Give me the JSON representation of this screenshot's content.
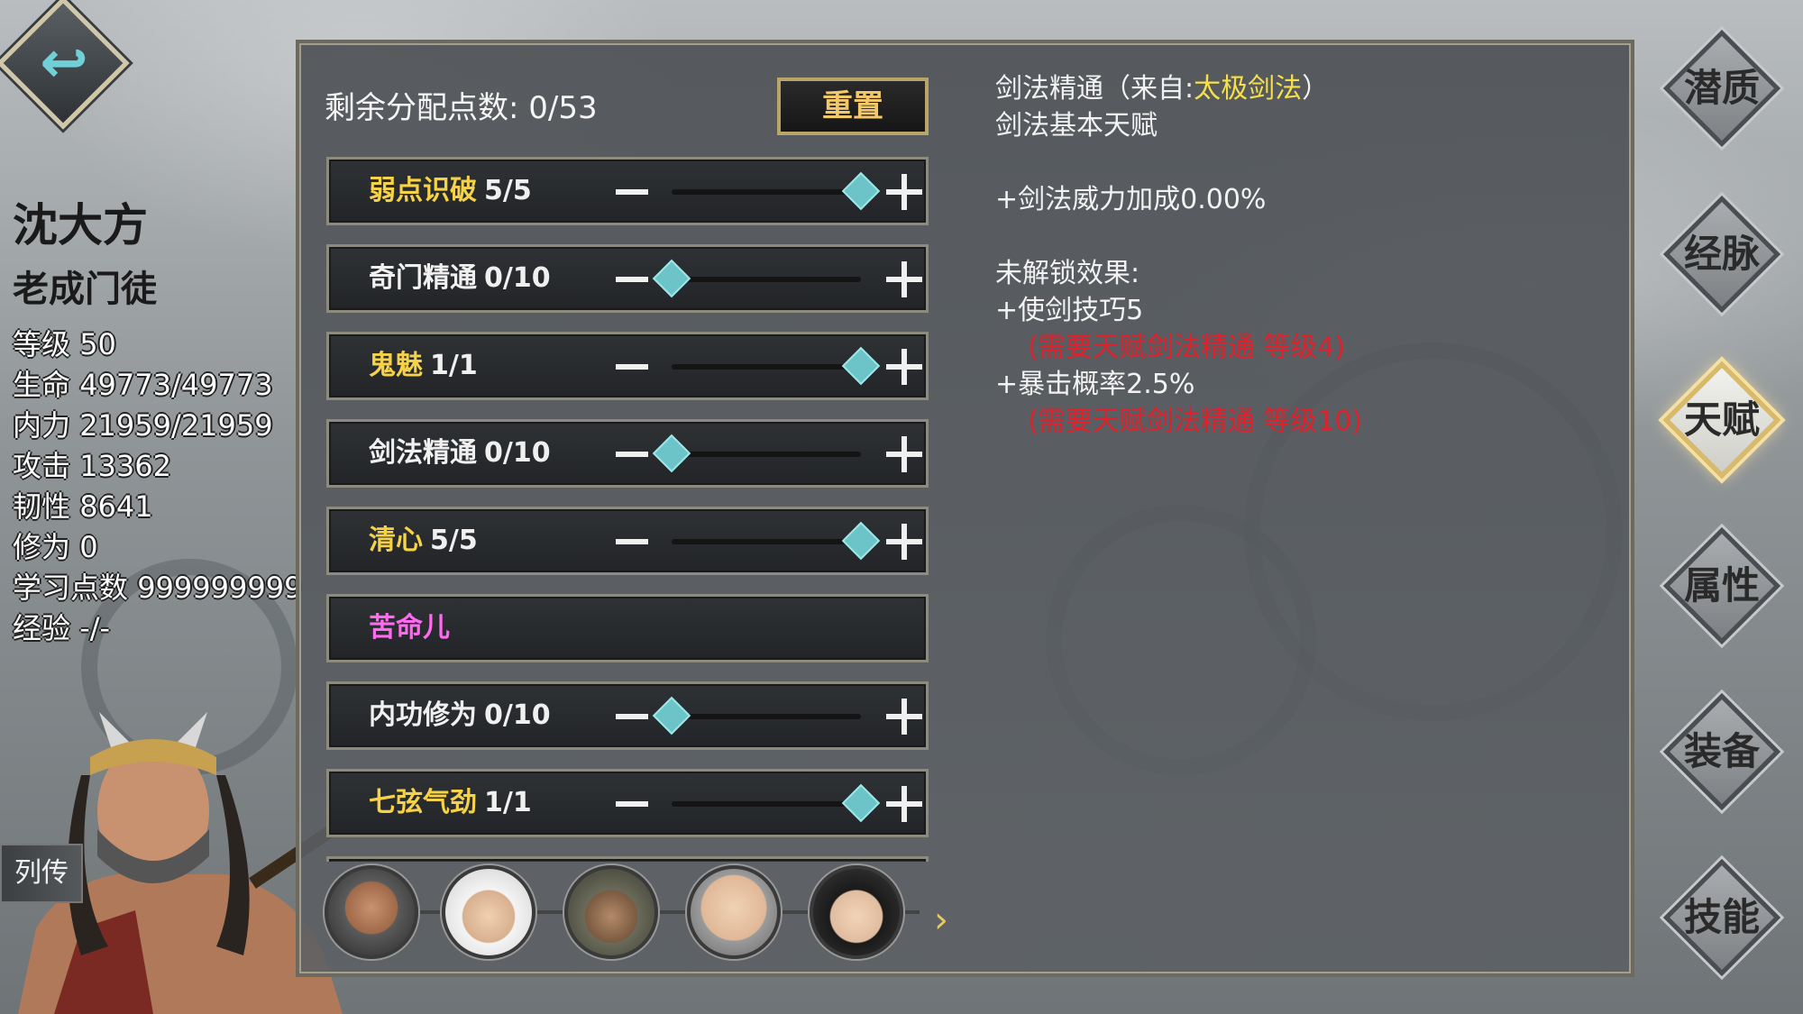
{
  "character": {
    "name": "沈大方",
    "title": "老成门徒",
    "stats": [
      {
        "label": "等级",
        "value": "50"
      },
      {
        "label": "生命",
        "value": "49773/49773"
      },
      {
        "label": "内力",
        "value": "21959/21959"
      },
      {
        "label": "攻击",
        "value": "13362"
      },
      {
        "label": "韧性",
        "value": "8641"
      },
      {
        "label": "修为",
        "value": "0"
      },
      {
        "label": "学习点数",
        "value": "999999999"
      },
      {
        "label": "经验",
        "value": "-/-"
      }
    ],
    "legend_button": "列传"
  },
  "points": {
    "label": "剩余分配点数: 0/53",
    "reset_label": "重置"
  },
  "talents": [
    {
      "name": "弱点识破",
      "level": "5/5",
      "color": "gold",
      "fill": 1.0
    },
    {
      "name": "奇门精通",
      "level": "0/10",
      "color": "white",
      "fill": 0.0
    },
    {
      "name": "鬼魅",
      "level": "1/1",
      "color": "gold",
      "fill": 1.0
    },
    {
      "name": "剑法精通",
      "level": "0/10",
      "color": "white",
      "fill": 0.0
    },
    {
      "name": "清心",
      "level": "5/5",
      "color": "gold",
      "fill": 1.0
    },
    {
      "name": "苦命儿",
      "level": "",
      "color": "pink",
      "fill": null
    },
    {
      "name": "内功修为",
      "level": "0/10",
      "color": "white",
      "fill": 0.0
    },
    {
      "name": "七弦气劲",
      "level": "1/1",
      "color": "gold",
      "fill": 1.0
    }
  ],
  "description": {
    "title_prefix": "剑法精通（来自:",
    "source": "太极剑法",
    "title_suffix": "）",
    "subtitle": "剑法基本天赋",
    "effect": "+剑法威力加成0.00%",
    "locked_header": "未解锁效果:",
    "effect1": "+使剑技巧5",
    "req1": "(需要天赋剑法精通 等级4)",
    "effect2": "+暴击概率2.5%",
    "req2": "(需要天赋剑法精通 等级10)"
  },
  "nav": [
    {
      "label": "潜质",
      "active": false
    },
    {
      "label": "经脉",
      "active": false
    },
    {
      "label": "天赋",
      "active": true
    },
    {
      "label": "属性",
      "active": false
    },
    {
      "label": "装备",
      "active": false
    },
    {
      "label": "技能",
      "active": false
    }
  ],
  "colors": {
    "gold": "#f6d248",
    "pink": "#ff6bf0",
    "highlight": "#f6e04a",
    "requirement": "#e0202a",
    "knob": "#6cc4c8"
  }
}
